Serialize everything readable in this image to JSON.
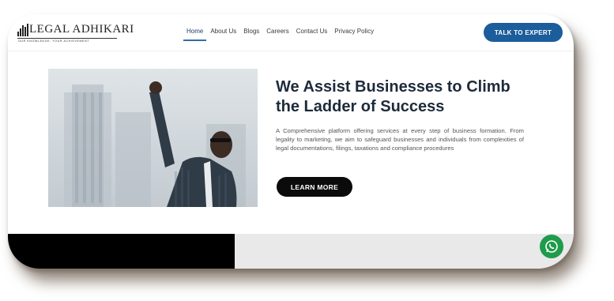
{
  "brand": {
    "name": "LEGAL ADHIKARI",
    "tagline": "OUR KNOWLEDGE, YOUR ACHIEVEMENT"
  },
  "nav": {
    "items": [
      {
        "label": "Home",
        "active": true
      },
      {
        "label": "About Us",
        "active": false
      },
      {
        "label": "Blogs",
        "active": false
      },
      {
        "label": "Careers",
        "active": false
      },
      {
        "label": "Contact Us",
        "active": false
      },
      {
        "label": "Privacy Policy",
        "active": false
      }
    ],
    "cta_label": "TALK TO EXPERT"
  },
  "hero": {
    "title": "We Assist Businesses to Climb the Ladder of Success",
    "description": "A Comprehensive platform offering services at every step of business formation. From legality to marketing, we aim to safeguard businesses and individuals from complexities of legal documentations, filings, taxations and compliance procedures",
    "button_label": "LEARN MORE"
  },
  "icons": {
    "whatsapp": "whatsapp-icon",
    "logo": "logo-bars-icon"
  },
  "colors": {
    "accent": "#1c5d9c",
    "dark": "#0b0b0b",
    "whatsapp": "#1f9b4c"
  }
}
